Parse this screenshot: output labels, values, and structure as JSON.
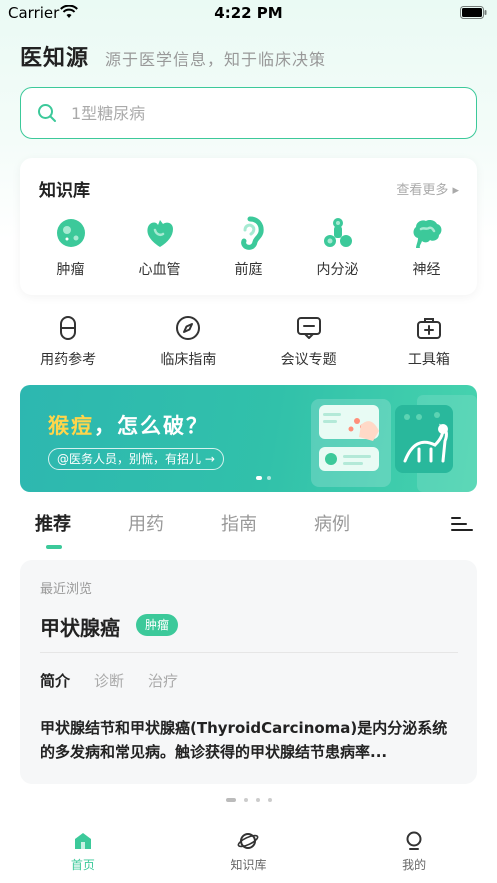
{
  "status_bar": {
    "carrier": "Carrier",
    "time": "4:22 PM"
  },
  "brand": {
    "name": "医知源",
    "slogan": "源于医学信息，知于临床决策"
  },
  "search": {
    "placeholder": "1型糖尿病",
    "value": ""
  },
  "knowledge_base": {
    "title": "知识库",
    "more": "查看更多",
    "items": [
      {
        "label": "肿瘤",
        "icon": "tumor-icon"
      },
      {
        "label": "心血管",
        "icon": "heart-icon"
      },
      {
        "label": "前庭",
        "icon": "ear-icon"
      },
      {
        "label": "内分泌",
        "icon": "endocrine-icon"
      },
      {
        "label": "神经",
        "icon": "brain-icon"
      }
    ]
  },
  "tools": [
    {
      "label": "用药参考",
      "icon": "pill-icon"
    },
    {
      "label": "临床指南",
      "icon": "compass-icon"
    },
    {
      "label": "会议专题",
      "icon": "conference-icon"
    },
    {
      "label": "工具箱",
      "icon": "toolbox-icon"
    }
  ],
  "banner": {
    "highlight": "猴痘",
    "title_rest": "，怎么破？",
    "subtitle": "@医务人员，别慌，有招儿 →"
  },
  "tabs": [
    {
      "label": "推荐",
      "active": true
    },
    {
      "label": "用药",
      "active": false
    },
    {
      "label": "指南",
      "active": false
    },
    {
      "label": "病例",
      "active": false
    }
  ],
  "recent": {
    "label": "最近浏览",
    "title": "甲状腺癌",
    "tag": "肿瘤",
    "subtabs": [
      {
        "label": "简介",
        "active": true
      },
      {
        "label": "诊断",
        "active": false
      },
      {
        "label": "治疗",
        "active": false
      }
    ],
    "description": "甲状腺结节和甲状腺癌(ThyroidCarcinoma)是内分泌系统的多发病和常见病。触诊获得的甲状腺结节患病率..."
  },
  "bottom_nav": [
    {
      "label": "首页",
      "icon": "home-icon",
      "active": true
    },
    {
      "label": "知识库",
      "icon": "planet-icon",
      "active": false
    },
    {
      "label": "我的",
      "icon": "user-icon",
      "active": false
    }
  ],
  "colors": {
    "accent": "#3cc99a",
    "banner": "#2db7b0",
    "banner_highlight": "#ffd54a"
  }
}
